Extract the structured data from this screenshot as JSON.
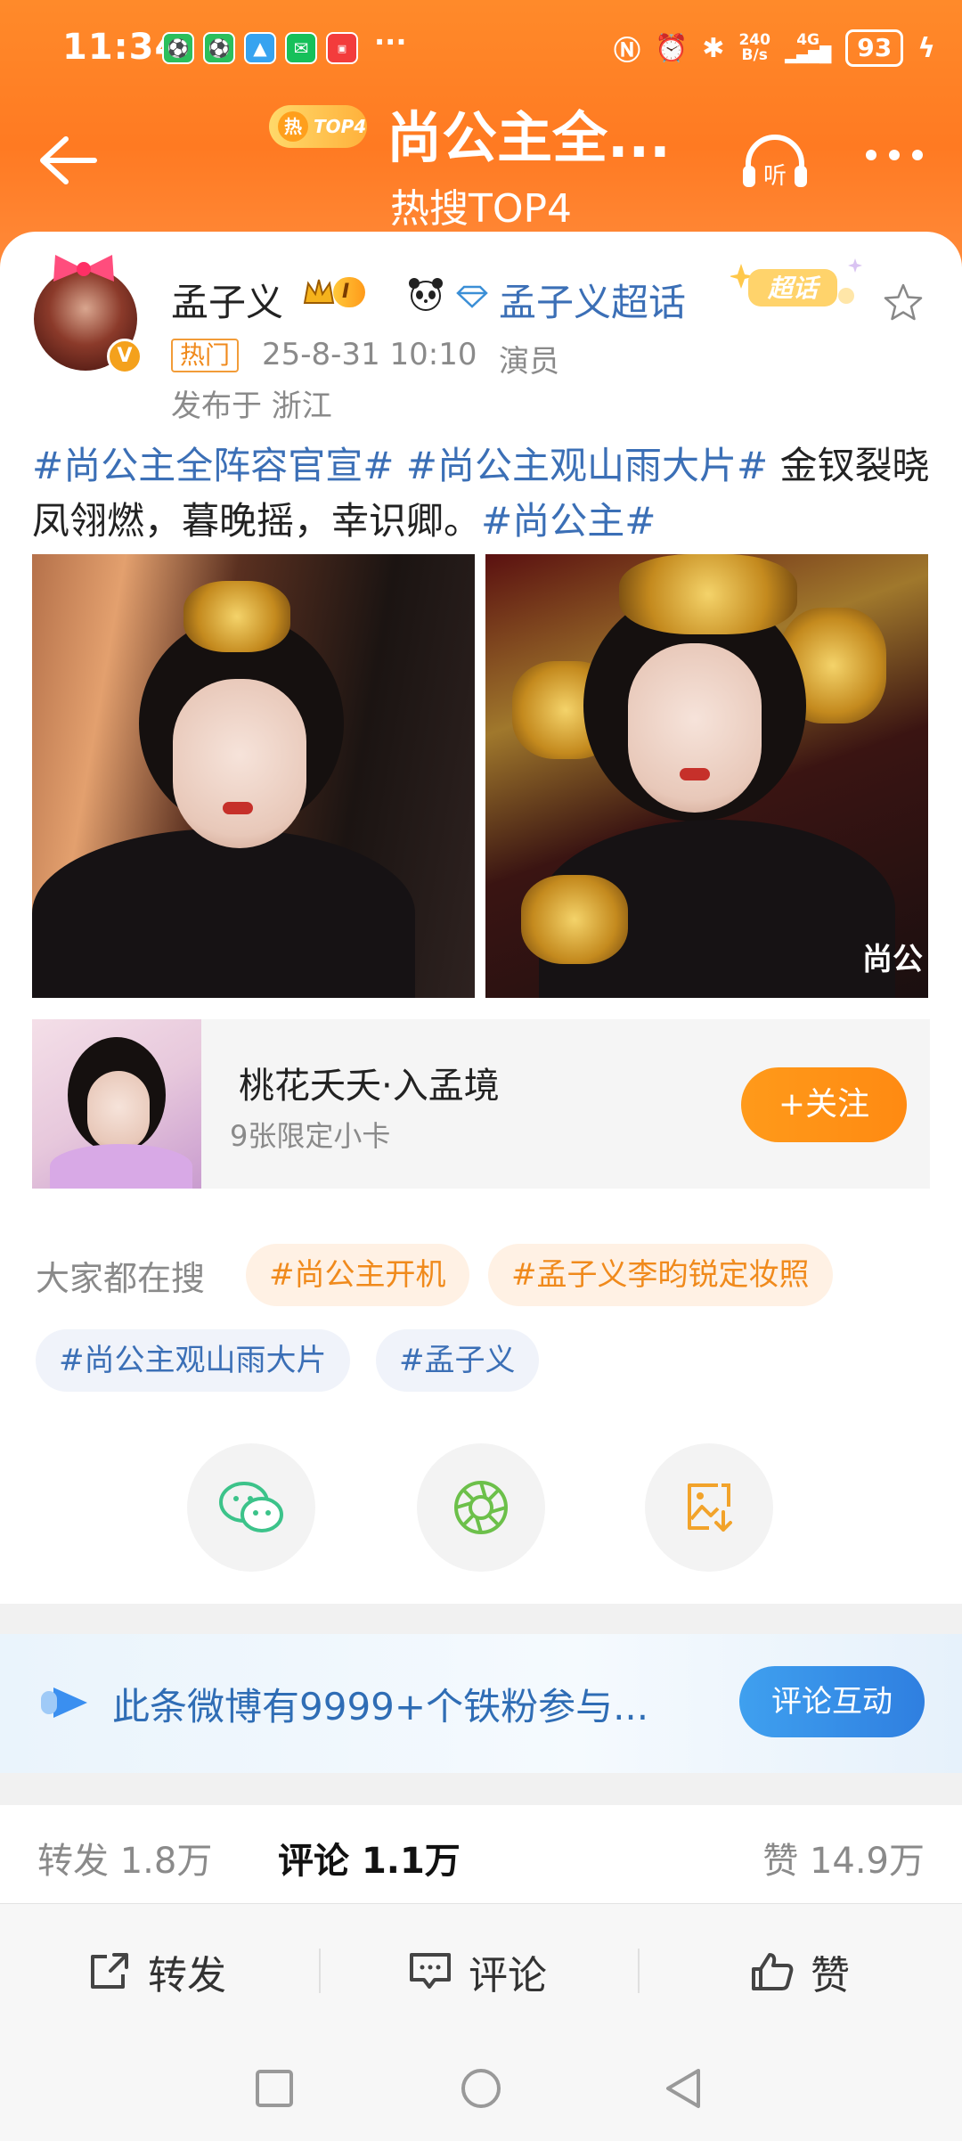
{
  "status": {
    "time": "11:34",
    "more": "···",
    "net_speed_top": "240",
    "net_speed_bottom": "B/s",
    "signal": "4G",
    "battery": "93"
  },
  "header": {
    "hot_badge_icon": "热",
    "hot_badge_label": "TOP4",
    "title": "尚公主全...",
    "subtitle": "热搜TOP4",
    "listen_label": "听"
  },
  "post": {
    "author": "孟子义",
    "level": "I",
    "supertopic_link": "孟子义超话",
    "supertopic_tag": "超话",
    "hot_tag": "热门",
    "time": "25-8-31 10:10",
    "role": "演员",
    "location": "发布于 浙江",
    "text": {
      "topic1": "#尚公主全阵容官宣#",
      "topic2": "#尚公主观山雨大片#",
      "body": " 金钗裂晓凤翎燃，暮晚摇，幸识卿。",
      "topic3": "#尚公主#"
    },
    "image_watermark": "尚公"
  },
  "promo": {
    "title": "桃花夭夭·入孟境",
    "subtitle": "9张限定小卡",
    "follow_label": "+关注"
  },
  "search": {
    "label": "大家都在搜",
    "chips": [
      "#尚公主开机",
      "#孟子义李昀锐定妆照",
      "#尚公主观山雨大片",
      "#孟子义"
    ]
  },
  "share": {
    "icons": [
      "wechat-icon",
      "moments-icon",
      "save-image-icon"
    ]
  },
  "fans_banner": {
    "text": "此条微博有9999+个铁粉参与...",
    "button": "评论互动"
  },
  "stats": {
    "repost_label": "转发",
    "repost_count": "1.8万",
    "comment_label": "评论",
    "comment_count": "1.1万",
    "like_label": "赞",
    "like_count": "14.9万"
  },
  "actions": {
    "repost": "转发",
    "comment": "评论",
    "like": "赞"
  },
  "colors": {
    "brand_orange": "#ff7a22",
    "topic_blue": "#3b6fb6",
    "follow_orange": "#ff9a1a"
  }
}
